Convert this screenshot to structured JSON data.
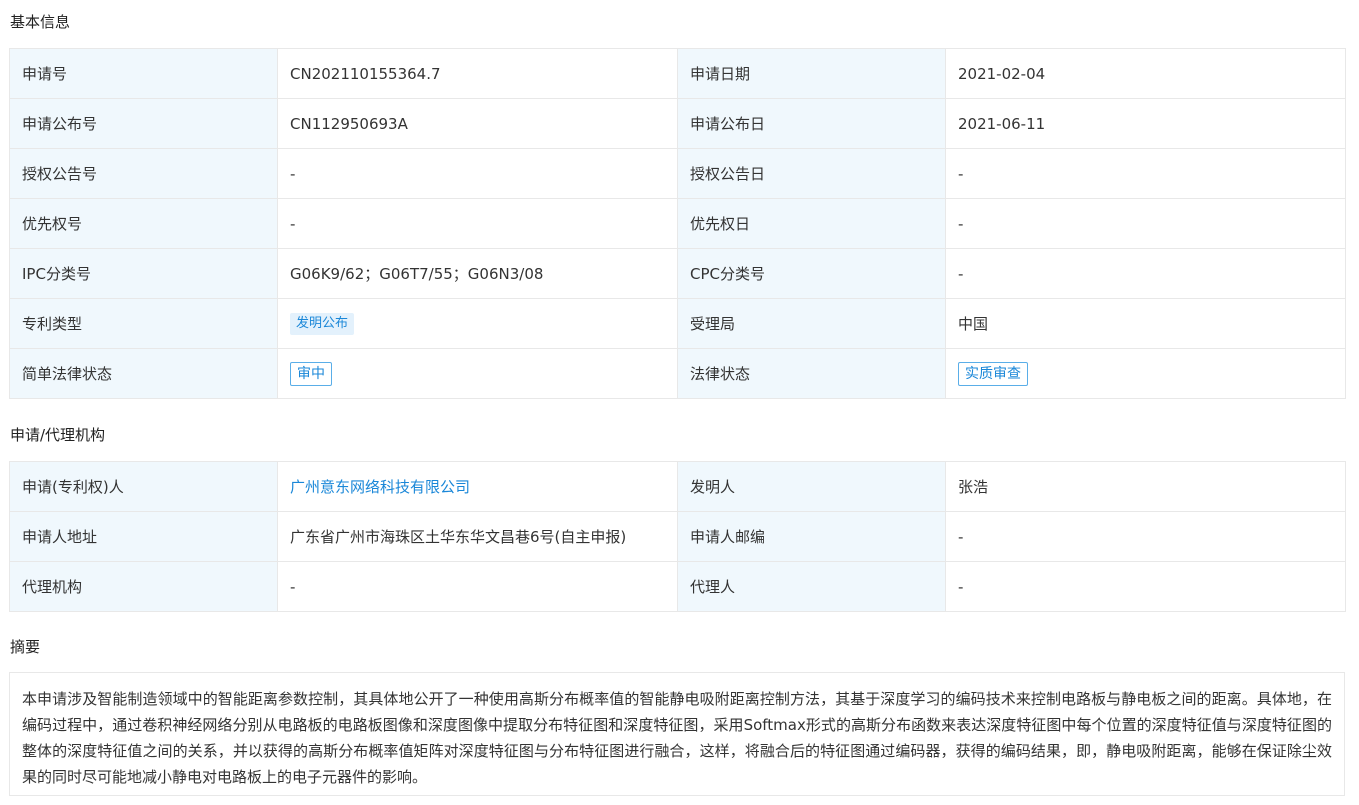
{
  "basic": {
    "title": "基本信息",
    "rows": [
      [
        {
          "label": "申请号",
          "value": "CN202110155364.7"
        },
        {
          "label": "申请日期",
          "value": "2021-02-04"
        }
      ],
      [
        {
          "label": "申请公布号",
          "value": "CN112950693A"
        },
        {
          "label": "申请公布日",
          "value": "2021-06-11"
        }
      ],
      [
        {
          "label": "授权公告号",
          "value": "-"
        },
        {
          "label": "授权公告日",
          "value": "-"
        }
      ],
      [
        {
          "label": "优先权号",
          "value": "-"
        },
        {
          "label": "优先权日",
          "value": "-"
        }
      ],
      [
        {
          "label": "IPC分类号",
          "value": "G06K9/62；G06T7/55；G06N3/08"
        },
        {
          "label": "CPC分类号",
          "value": "-"
        }
      ],
      [
        {
          "label": "专利类型",
          "value": "发明公布"
        },
        {
          "label": "受理局",
          "value": "中国"
        }
      ],
      [
        {
          "label": "简单法律状态",
          "value": "审中"
        },
        {
          "label": "法律状态",
          "value": "实质审查"
        }
      ]
    ]
  },
  "agency": {
    "title": "申请/代理机构",
    "rows": [
      [
        {
          "label": "申请(专利权)人",
          "value": "广州意东网络科技有限公司"
        },
        {
          "label": "发明人",
          "value": "张浩"
        }
      ],
      [
        {
          "label": "申请人地址",
          "value": "广东省广州市海珠区土华东华文昌巷6号(自主申报)"
        },
        {
          "label": "申请人邮编",
          "value": "-"
        }
      ],
      [
        {
          "label": "代理机构",
          "value": "-"
        },
        {
          "label": "代理人",
          "value": "-"
        }
      ]
    ]
  },
  "abstract": {
    "title": "摘要",
    "text": "本申请涉及智能制造领域中的智能距离参数控制，其具体地公开了一种使用高斯分布概率值的智能静电吸附距离控制方法，其基于深度学习的编码技术来控制电路板与静电板之间的距离。具体地，在编码过程中，通过卷积神经网络分别从电路板的电路板图像和深度图像中提取分布特征图和深度特征图，采用Softmax形式的高斯分布函数来表达深度特征图中每个位置的深度特征值与深度特征图的整体的深度特征值之间的关系，并以获得的高斯分布概率值矩阵对深度特征图与分布特征图进行融合，这样，将融合后的特征图通过编码器，获得的编码结果，即，静电吸附距离，能够在保证除尘效果的同时尽可能地减小静电对电路板上的电子元器件的影响。"
  }
}
